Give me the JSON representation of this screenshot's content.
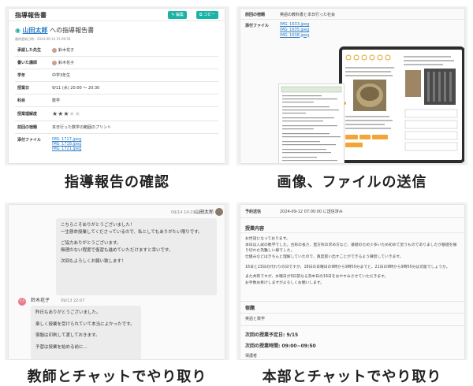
{
  "captions": {
    "c1": "指導報告の確認",
    "c2": "画像、ファイルの送信",
    "c3": "教師とチャットでやり取り",
    "c4": "本部とチャットでやり取り"
  },
  "report": {
    "title": "指導報告書",
    "edit_btn": "編集",
    "copy_btn": "コピー",
    "student_name": "山田太郎",
    "student_suffix": "への指導報告書",
    "date_line": "最終更新日時：2024-09-14 15:09:56",
    "rows": [
      {
        "key": "承認した先生",
        "value": "鈴木花子"
      },
      {
        "key": "書いた講師",
        "value": "鈴木花子"
      },
      {
        "key": "学年",
        "value": "中学3年生"
      },
      {
        "key": "授業日",
        "value": "9/11 (水) 20:00 〜 20:30"
      },
      {
        "key": "科目",
        "value": "数学"
      },
      {
        "key": "授業理解度",
        "value": ""
      },
      {
        "key": "前回の宿題",
        "value": "本日行った数学の範囲のプリント"
      },
      {
        "key": "添付ファイル",
        "value": ""
      }
    ],
    "rating": 3,
    "rating_max": 5,
    "files": [
      "IMG_1717.jpeg",
      "IMG_1718.jpeg",
      "IMG_1721.jpeg"
    ]
  },
  "upload": {
    "row1_key": "前回の宿題",
    "row1_value": "英語の教科書と本日行った社会",
    "row2_key": "添付ファイル",
    "files": [
      "IMG_1633.jpeg",
      "IMG_1635.jpeg",
      "IMG_1638.jpeg"
    ]
  },
  "teacher_chat": {
    "my_time": "09/14 14:19",
    "my_name": "山田太郎",
    "my_msg_1": "こちらこそありがとうございました！",
    "my_msg_2": "一生懸命授業してくださっているので、私としてもありがたい限りです。",
    "my_msg_3": "ご協力ありがとうございます。",
    "my_msg_4": "無理のない程度で復習も進めていただけますと幸いです。",
    "my_msg_5": "次回もよろしくお願い致します！",
    "teacher_name": "鈴木花子",
    "teacher_time": "09/13 22:07",
    "t_msg_1": "昨日もありがとうございました。",
    "t_msg_2": "楽しく授業を受けられていて本当によかったです。",
    "t_msg_3": "宿題は印刷して渡しておきます。",
    "t_msg_4": "予習は授業を始める前に..."
  },
  "hq_chat": {
    "req_key": "予約送信",
    "req_value": "2024-09-12 07:00:00 に送信済み",
    "section1": "授業内容",
    "body_lines": [
      "お世話になっております。",
      "本日は入試の数学でした。台形の長さ、直方形の求め方など、基礎のため少多いため初めて習うものでありましたが基礎を振り切れた為難しい様でした。",
      "仕組みなどはきちんと理解していたので、再度思い出すことができるよう練習していきます。",
      "16日と23日の代わりの日ですが、18日の日曜日の9時から9時50分までと、21日の9時から9時50分は可能でしょうか。",
      "また共有ですが、水曜日が9日前なる為中日の16日をおやすみさせていただきます。",
      "お手数お掛けしますがよろしくお願いします。"
    ],
    "section2": "宿題",
    "homework": "英語と数学",
    "next_date": "次回の授業予定日: 9/15",
    "next_time": "次回の授業時間: 09:00~09:50",
    "footer": "保護者"
  }
}
